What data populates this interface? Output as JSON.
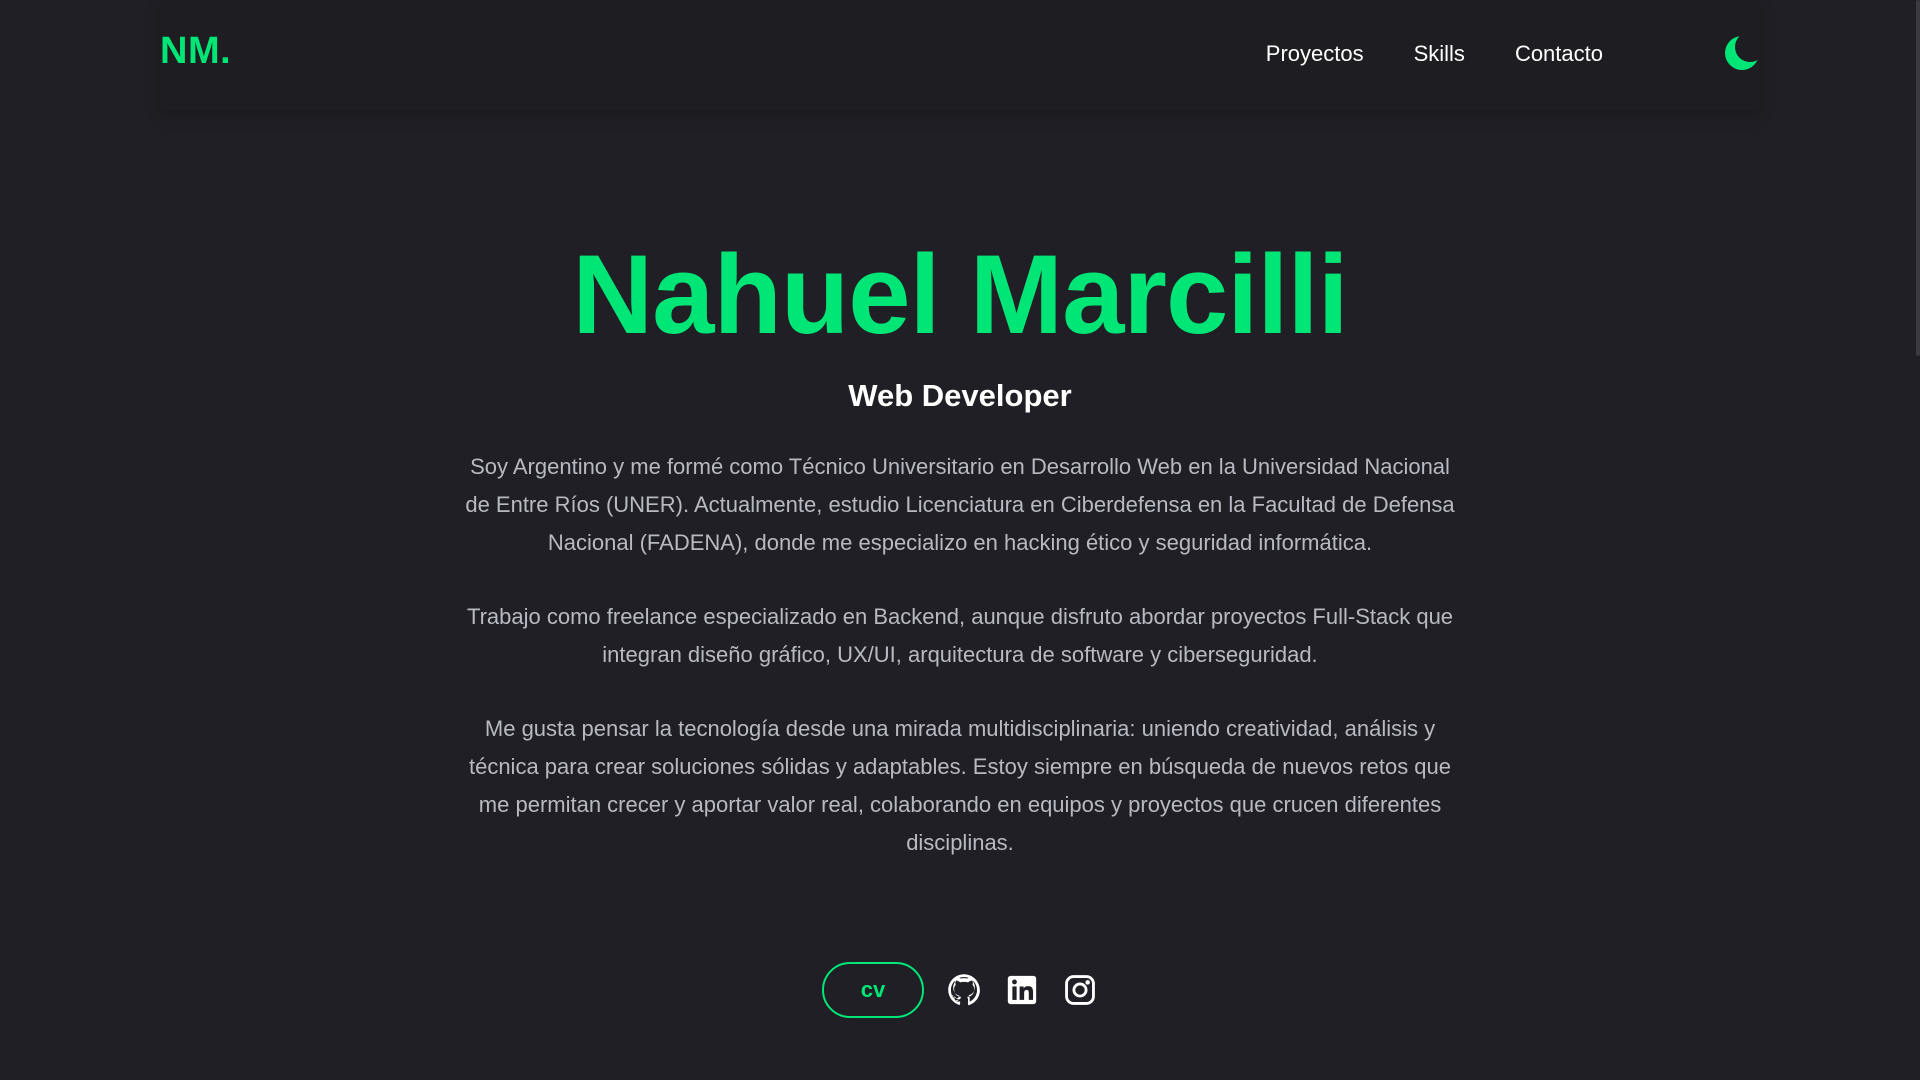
{
  "header": {
    "logo": "NM.",
    "nav": [
      "Proyectos",
      "Skills",
      "Contacto"
    ],
    "theme_icon": "moon-icon"
  },
  "hero": {
    "name": "Nahuel Marcilli",
    "role": "Web Developer",
    "bio": [
      "Soy Argentino y me formé como Técnico Universitario en Desarrollo Web en la Universidad Nacional de Entre Ríos (UNER). Actualmente, estudio Licenciatura en Ciberdefensa en la Facultad de Defensa Nacional (FADENA), donde me especializo en hacking ético y seguridad informática.",
      "Trabajo como freelance especializado en Backend, aunque disfruto abordar proyectos Full-Stack que integran diseño gráfico, UX/UI, arquitectura de software y ciberseguridad.",
      "Me gusta pensar la tecnología desde una mirada multidisciplinaria: uniendo creatividad, análisis y técnica para crear soluciones sólidas y adaptables. Estoy siempre en búsqueda de nuevos retos que me permitan crecer y aportar valor real, colaborando en equipos y proyectos que crucen diferentes disciplinas."
    ],
    "cv_label": "cv",
    "social_icons": [
      "github-icon",
      "linkedin-icon",
      "instagram-icon"
    ]
  },
  "colors": {
    "accent": "#00e676",
    "background": "#1f1f25",
    "text": "#b9b9c3"
  }
}
